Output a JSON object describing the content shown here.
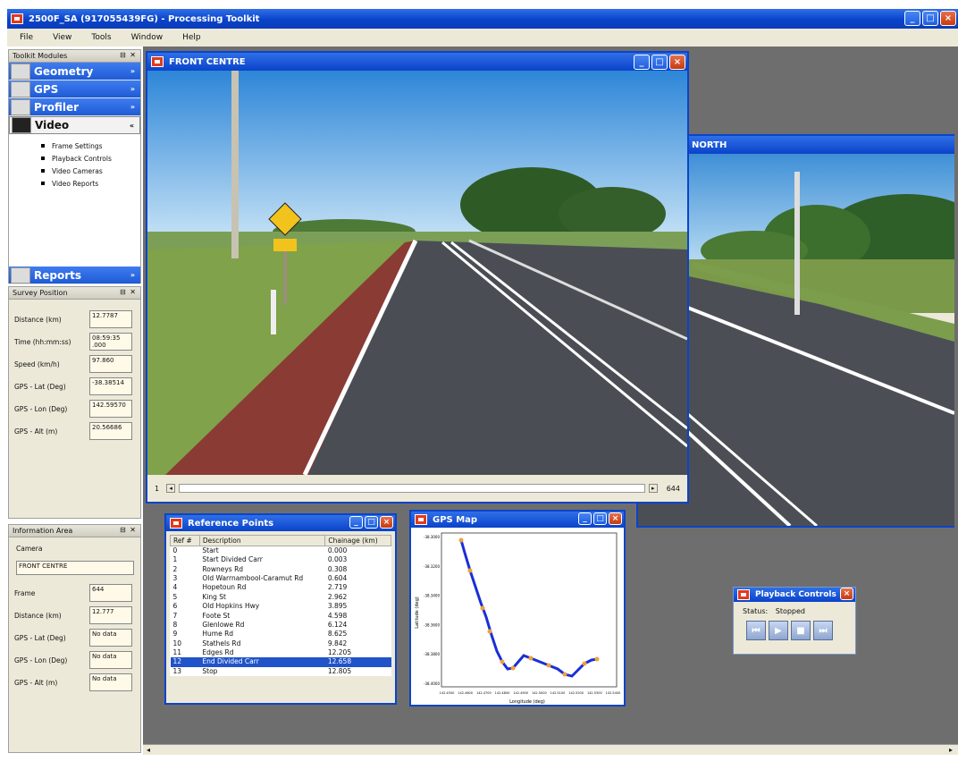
{
  "app": {
    "title": "2500F_SA (917055439FG) - Processing Toolkit",
    "window_buttons": [
      "_",
      "□",
      "×"
    ]
  },
  "menu": [
    "File",
    "View",
    "Tools",
    "Window",
    "Help"
  ],
  "toolkit": {
    "title": "Toolkit Modules",
    "modules": [
      "Geometry",
      "GPS",
      "Profiler",
      "Video",
      "Reports"
    ],
    "video_items": [
      "Frame Settings",
      "Playback Controls",
      "Video Cameras",
      "Video Reports"
    ]
  },
  "survey": {
    "title": "Survey Position",
    "fields": [
      {
        "label": "Distance (km)",
        "value": "12.7787"
      },
      {
        "label": "Time (hh:mm:ss)",
        "value": "08:59:35 .000"
      },
      {
        "label": "Speed (km/h)",
        "value": "97.860"
      },
      {
        "label": "GPS - Lat (Deg)",
        "value": "-38.38514"
      },
      {
        "label": "GPS - Lon (Deg)",
        "value": "142.59570"
      },
      {
        "label": "GPS - Alt (m)",
        "value": "20.56686"
      }
    ]
  },
  "info": {
    "title": "Information Area",
    "camera_label": "Camera",
    "camera_value": "FRONT CENTRE",
    "fields": [
      {
        "label": "Frame",
        "value": "644"
      },
      {
        "label": "Distance (km)",
        "value": "12.777"
      },
      {
        "label": "GPS - Lat (Deg)",
        "value": "No data"
      },
      {
        "label": "GPS - Lon (Deg)",
        "value": "No data"
      },
      {
        "label": "GPS - Alt (m)",
        "value": "No data"
      }
    ]
  },
  "front_window": {
    "title": "FRONT CENTRE",
    "slider_left": "1",
    "slider_right": "644"
  },
  "side_window": {
    "title": "NORTH"
  },
  "reference_points": {
    "title": "Reference Points",
    "columns": [
      "Ref #",
      "Description",
      "Chainage (km)"
    ],
    "rows": [
      [
        "0",
        "Start",
        "0.000"
      ],
      [
        "1",
        "Start Divided Carr",
        "0.003"
      ],
      [
        "2",
        "Rowneys Rd",
        "0.308"
      ],
      [
        "3",
        "Old Warrnambool-Caramut Rd",
        "0.604"
      ],
      [
        "4",
        "Hopetoun Rd",
        "2.719"
      ],
      [
        "5",
        "King St",
        "2.962"
      ],
      [
        "6",
        "Old Hopkins Hwy",
        "3.895"
      ],
      [
        "7",
        "Foote St",
        "4.598"
      ],
      [
        "8",
        "Glenlowe Rd",
        "6.124"
      ],
      [
        "9",
        "Hume Rd",
        "8.625"
      ],
      [
        "10",
        "Stathels Rd",
        "9.842"
      ],
      [
        "11",
        "Edges Rd",
        "12.205"
      ],
      [
        "12",
        "End Divided Carr",
        "12.658"
      ],
      [
        "13",
        "Stop",
        "12.805"
      ]
    ],
    "selected_row": 12
  },
  "gps_map": {
    "title": "GPS Map",
    "y_ticks": [
      "-38.3000",
      "-38.3200",
      "-38.3400",
      "-38.3600",
      "-38.3800",
      "-38.4000"
    ],
    "x_ticks": [
      "142.4500",
      "142.4600",
      "142.4700",
      "142.4800",
      "142.4900",
      "142.5000",
      "142.5100",
      "142.5200",
      "142.5300",
      "142.5400"
    ],
    "xlabel": "Longitude (deg)",
    "ylabel": "Latitude (deg)"
  },
  "playback": {
    "title": "Playback Controls",
    "status_label": "Status:",
    "status_value": "Stopped"
  },
  "colors": {
    "title_blue": "#0a43c9",
    "workspace": "#6e6e6e",
    "selection": "#2153c9"
  }
}
